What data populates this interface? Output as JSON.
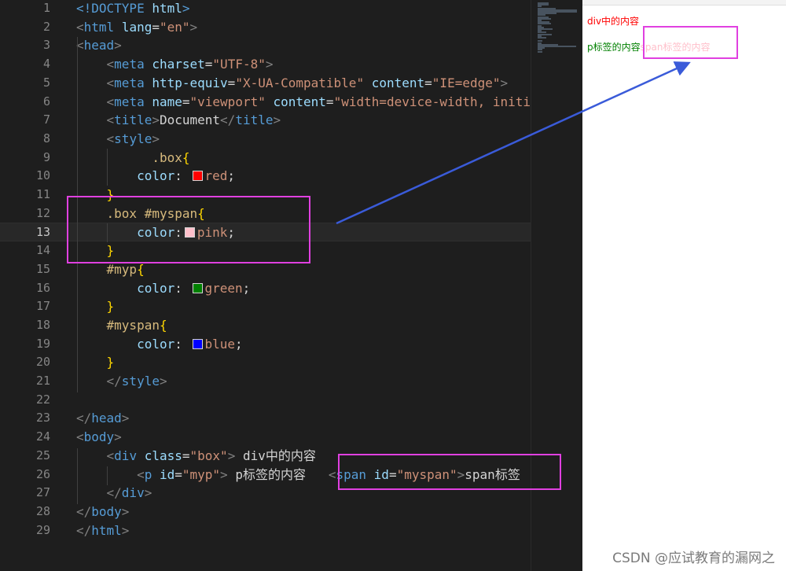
{
  "editor": {
    "lines": [
      {
        "num": "1",
        "segs": [
          [
            "t-tag",
            "<!DOCTYPE "
          ],
          [
            "t-attr",
            "html"
          ],
          [
            "t-tag",
            ">"
          ]
        ]
      },
      {
        "num": "2",
        "segs": [
          [
            "t-punc",
            "<"
          ],
          [
            "t-tag",
            "html "
          ],
          [
            "t-attr",
            "lang"
          ],
          [
            "t-text",
            "="
          ],
          [
            "t-str",
            "\"en\""
          ],
          [
            "t-punc",
            ">"
          ]
        ]
      },
      {
        "num": "3",
        "segs": [
          [
            "t-punc",
            "<"
          ],
          [
            "t-tag",
            "head"
          ],
          [
            "t-punc",
            ">"
          ]
        ]
      },
      {
        "num": "4",
        "segs": [
          [
            "t-text",
            "    "
          ],
          [
            "t-punc",
            "<"
          ],
          [
            "t-tag",
            "meta "
          ],
          [
            "t-attr",
            "charset"
          ],
          [
            "t-text",
            "="
          ],
          [
            "t-str",
            "\"UTF-8\""
          ],
          [
            "t-punc",
            ">"
          ]
        ]
      },
      {
        "num": "5",
        "segs": [
          [
            "t-text",
            "    "
          ],
          [
            "t-punc",
            "<"
          ],
          [
            "t-tag",
            "meta "
          ],
          [
            "t-attr",
            "http-equiv"
          ],
          [
            "t-text",
            "="
          ],
          [
            "t-str",
            "\"X-UA-Compatible\""
          ],
          [
            "t-text",
            " "
          ],
          [
            "t-attr",
            "content"
          ],
          [
            "t-text",
            "="
          ],
          [
            "t-str",
            "\"IE=edge\""
          ],
          [
            "t-punc",
            ">"
          ]
        ]
      },
      {
        "num": "6",
        "segs": [
          [
            "t-text",
            "    "
          ],
          [
            "t-punc",
            "<"
          ],
          [
            "t-tag",
            "meta "
          ],
          [
            "t-attr",
            "name"
          ],
          [
            "t-text",
            "="
          ],
          [
            "t-str",
            "\"viewport\""
          ],
          [
            "t-text",
            " "
          ],
          [
            "t-attr",
            "content"
          ],
          [
            "t-text",
            "="
          ],
          [
            "t-str",
            "\"width=device-width, initi"
          ]
        ]
      },
      {
        "num": "7",
        "segs": [
          [
            "t-text",
            "    "
          ],
          [
            "t-punc",
            "<"
          ],
          [
            "t-tag",
            "title"
          ],
          [
            "t-punc",
            ">"
          ],
          [
            "t-text",
            "Document"
          ],
          [
            "t-punc",
            "</"
          ],
          [
            "t-tag",
            "title"
          ],
          [
            "t-punc",
            ">"
          ]
        ]
      },
      {
        "num": "8",
        "segs": [
          [
            "t-text",
            "    "
          ],
          [
            "t-punc",
            "<"
          ],
          [
            "t-tag",
            "style"
          ],
          [
            "t-punc",
            ">"
          ]
        ]
      },
      {
        "num": "9",
        "segs": [
          [
            "t-text",
            "          "
          ],
          [
            "t-sel",
            ".box"
          ],
          [
            "t-brace",
            "{"
          ]
        ]
      },
      {
        "num": "10",
        "segs": [
          [
            "t-text",
            "        "
          ],
          [
            "t-prop",
            "color"
          ],
          [
            "t-text",
            ": "
          ],
          [
            "swatch",
            "#ff0000"
          ],
          [
            "t-val",
            "red"
          ],
          [
            "t-text",
            ";"
          ]
        ]
      },
      {
        "num": "11",
        "segs": [
          [
            "t-text",
            "    "
          ],
          [
            "t-brace",
            "}"
          ]
        ]
      },
      {
        "num": "12",
        "segs": [
          [
            "t-text",
            "    "
          ],
          [
            "t-sel",
            ".box #myspan"
          ],
          [
            "t-brace",
            "{"
          ]
        ]
      },
      {
        "num": "13",
        "segs": [
          [
            "t-text",
            "        "
          ],
          [
            "t-prop",
            "color"
          ],
          [
            "t-text",
            ":"
          ],
          [
            "swatch",
            "#ffc0cb"
          ],
          [
            "t-val",
            "pink"
          ],
          [
            "t-text",
            ";"
          ]
        ],
        "current": true
      },
      {
        "num": "14",
        "segs": [
          [
            "t-text",
            "    "
          ],
          [
            "t-brace",
            "}"
          ]
        ]
      },
      {
        "num": "15",
        "segs": [
          [
            "t-text",
            "    "
          ],
          [
            "t-sel",
            "#myp"
          ],
          [
            "t-brace",
            "{"
          ]
        ]
      },
      {
        "num": "16",
        "segs": [
          [
            "t-text",
            "        "
          ],
          [
            "t-prop",
            "color"
          ],
          [
            "t-text",
            ": "
          ],
          [
            "swatch",
            "#008000"
          ],
          [
            "t-val",
            "green"
          ],
          [
            "t-text",
            ";"
          ]
        ]
      },
      {
        "num": "17",
        "segs": [
          [
            "t-text",
            "    "
          ],
          [
            "t-brace",
            "}"
          ]
        ]
      },
      {
        "num": "18",
        "segs": [
          [
            "t-text",
            "    "
          ],
          [
            "t-sel",
            "#myspan"
          ],
          [
            "t-brace",
            "{"
          ]
        ]
      },
      {
        "num": "19",
        "segs": [
          [
            "t-text",
            "        "
          ],
          [
            "t-prop",
            "color"
          ],
          [
            "t-text",
            ": "
          ],
          [
            "swatch",
            "#0000ff"
          ],
          [
            "t-val",
            "blue"
          ],
          [
            "t-text",
            ";"
          ]
        ]
      },
      {
        "num": "20",
        "segs": [
          [
            "t-text",
            "    "
          ],
          [
            "t-brace",
            "}"
          ]
        ]
      },
      {
        "num": "21",
        "segs": [
          [
            "t-text",
            "    "
          ],
          [
            "t-punc",
            "</"
          ],
          [
            "t-tag",
            "style"
          ],
          [
            "t-punc",
            ">"
          ]
        ]
      },
      {
        "num": "22",
        "segs": []
      },
      {
        "num": "23",
        "segs": [
          [
            "t-punc",
            "</"
          ],
          [
            "t-tag",
            "head"
          ],
          [
            "t-punc",
            ">"
          ]
        ]
      },
      {
        "num": "24",
        "segs": [
          [
            "t-punc",
            "<"
          ],
          [
            "t-tag",
            "body"
          ],
          [
            "t-punc",
            ">"
          ]
        ]
      },
      {
        "num": "25",
        "segs": [
          [
            "t-text",
            "    "
          ],
          [
            "t-punc",
            "<"
          ],
          [
            "t-tag",
            "div "
          ],
          [
            "t-attr",
            "class"
          ],
          [
            "t-text",
            "="
          ],
          [
            "t-str",
            "\"box\""
          ],
          [
            "t-punc",
            ">"
          ],
          [
            "t-text",
            " div中的内容"
          ]
        ]
      },
      {
        "num": "26",
        "segs": [
          [
            "t-text",
            "        "
          ],
          [
            "t-punc",
            "<"
          ],
          [
            "t-tag",
            "p "
          ],
          [
            "t-attr",
            "id"
          ],
          [
            "t-text",
            "="
          ],
          [
            "t-str",
            "\"myp\""
          ],
          [
            "t-punc",
            ">"
          ],
          [
            "t-text",
            " p标签的内容   "
          ],
          [
            "t-punc",
            "<"
          ],
          [
            "t-tag",
            "span "
          ],
          [
            "t-attr",
            "id"
          ],
          [
            "t-text",
            "="
          ],
          [
            "t-str",
            "\"myspan\""
          ],
          [
            "t-punc",
            ">"
          ],
          [
            "t-text",
            "span标签"
          ]
        ]
      },
      {
        "num": "27",
        "segs": [
          [
            "t-text",
            "    "
          ],
          [
            "t-punc",
            "</"
          ],
          [
            "t-tag",
            "div"
          ],
          [
            "t-punc",
            ">"
          ]
        ]
      },
      {
        "num": "28",
        "segs": [
          [
            "t-punc",
            "</"
          ],
          [
            "t-tag",
            "body"
          ],
          [
            "t-punc",
            ">"
          ]
        ]
      },
      {
        "num": "29",
        "segs": [
          [
            "t-punc",
            "</"
          ],
          [
            "t-tag",
            "html"
          ],
          [
            "t-punc",
            ">"
          ]
        ]
      }
    ]
  },
  "preview": {
    "div_text": "div中的内容",
    "p_text": "p标签的内容",
    "span_text": "span标签的内容"
  },
  "colors": {
    "highlight": "#e040e0",
    "arrow": "#3a5bd9"
  },
  "watermark": "CSDN @应试教育的漏网之"
}
